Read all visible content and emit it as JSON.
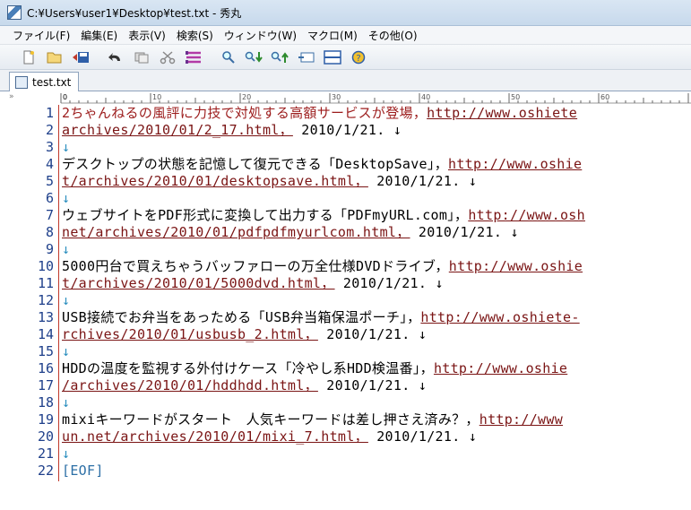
{
  "window": {
    "title": "C:¥Users¥user1¥Desktop¥test.txt  - 秀丸"
  },
  "menu": [
    "ファイル(F)",
    "編集(E)",
    "表示(V)",
    "検索(S)",
    "ウィンドウ(W)",
    "マクロ(M)",
    "その他(O)"
  ],
  "toolbar": [
    {
      "name": "new-file-icon",
      "glyph": "📄"
    },
    {
      "name": "open-folder-icon",
      "glyph": "📂"
    },
    {
      "name": "save-icon",
      "glyph": "💾"
    },
    {
      "name": "undo-icon",
      "glyph": "↶"
    },
    {
      "name": "copy-icon",
      "glyph": "▭"
    },
    {
      "name": "cut-icon",
      "glyph": "✂"
    },
    {
      "name": "paste-icon",
      "glyph": "☰"
    },
    {
      "name": "find-icon",
      "glyph": "🔍"
    },
    {
      "name": "find-next-icon",
      "glyph": "🔍↓"
    },
    {
      "name": "find-prev-icon",
      "glyph": "🔍↑"
    },
    {
      "name": "grep-icon",
      "glyph": "⇆"
    },
    {
      "name": "split-window-icon",
      "glyph": "▤"
    },
    {
      "name": "help-icon",
      "glyph": "❓"
    }
  ],
  "tab": {
    "label": "test.txt"
  },
  "ruler": {
    "marker": "»"
  },
  "lines": [
    {
      "n": "1",
      "text": "2ちゃんねるの風評に力技で対処する高額サービスが登場，",
      "link": "http://www.oshiete",
      "tail": ""
    },
    {
      "n": "2",
      "text": "",
      "link": "archives/2010/01/2_17.html，",
      "tail": " 2010/1/21. ↓"
    },
    {
      "n": "3",
      "text": "↓",
      "link": "",
      "tail": ""
    },
    {
      "n": "4",
      "text": "デスクトップの状態を記憶して復元できる「DesktopSave」，",
      "link": "http://www.oshie",
      "tail": ""
    },
    {
      "n": "5",
      "text": "",
      "link": "t/archives/2010/01/desktopsave.html，",
      "tail": " 2010/1/21. ↓"
    },
    {
      "n": "6",
      "text": "↓",
      "link": "",
      "tail": ""
    },
    {
      "n": "7",
      "text": "ウェブサイトをPDF形式に変換して出力する「PDFmyURL.com」，",
      "link": "http://www.osh",
      "tail": ""
    },
    {
      "n": "8",
      "text": "",
      "link": "net/archives/2010/01/pdfpdfmyurlcom.html，",
      "tail": " 2010/1/21. ↓"
    },
    {
      "n": "9",
      "text": "↓",
      "link": "",
      "tail": ""
    },
    {
      "n": "10",
      "text": "5000円台で買えちゃうバッファローの万全仕様DVDドライブ，",
      "link": "http://www.oshie",
      "tail": ""
    },
    {
      "n": "11",
      "text": "",
      "link": "t/archives/2010/01/5000dvd.html，",
      "tail": " 2010/1/21. ↓"
    },
    {
      "n": "12",
      "text": "↓",
      "link": "",
      "tail": ""
    },
    {
      "n": "13",
      "text": "USB接続でお弁当をあっためる「USB弁当箱保温ポーチ」，",
      "link": "http://www.oshiete-",
      "tail": ""
    },
    {
      "n": "14",
      "text": "",
      "link": "rchives/2010/01/usbusb_2.html，",
      "tail": " 2010/1/21. ↓"
    },
    {
      "n": "15",
      "text": "↓",
      "link": "",
      "tail": ""
    },
    {
      "n": "16",
      "text": "HDDの温度を監視する外付けケース「冷やし系HDD検温番」，",
      "link": "http://www.oshie",
      "tail": ""
    },
    {
      "n": "17",
      "text": "",
      "link": "/archives/2010/01/hddhdd.html，",
      "tail": " 2010/1/21. ↓"
    },
    {
      "n": "18",
      "text": "↓",
      "link": "",
      "tail": ""
    },
    {
      "n": "19",
      "text": "mixiキーワードがスタート　人気キーワードは差し押さえ済み？，",
      "link": "http://www",
      "tail": ""
    },
    {
      "n": "20",
      "text": "",
      "link": "un.net/archives/2010/01/mixi_7.html，",
      "tail": " 2010/1/21. ↓"
    },
    {
      "n": "21",
      "text": "↓",
      "link": "",
      "tail": ""
    },
    {
      "n": "22",
      "text": "[EOF]",
      "link": "",
      "tail": ""
    }
  ]
}
